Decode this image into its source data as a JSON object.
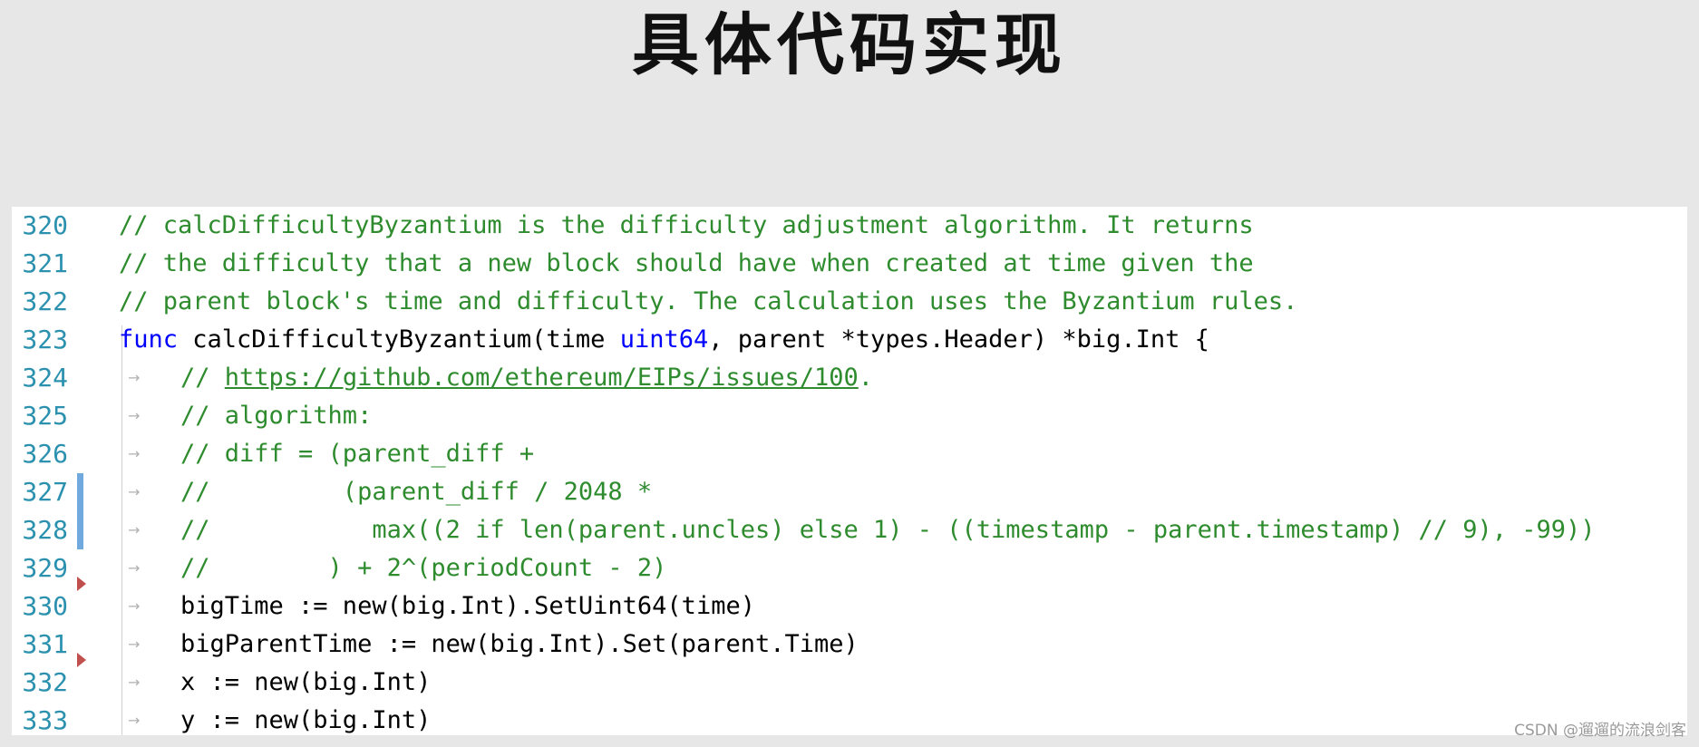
{
  "slide": {
    "title": "具体代码实现",
    "watermark": "CSDN @遛遛的流浪剑客"
  },
  "editor": {
    "lines": [
      {
        "num": "320",
        "comment": "// calcDifficultyByzantium is the difficulty adjustment algorithm. It returns"
      },
      {
        "num": "321",
        "comment": "// the difficulty that a new block should have when created at time given the"
      },
      {
        "num": "322",
        "comment": "// parent block's time and difficulty. The calculation uses the Byzantium rules."
      },
      {
        "num": "323",
        "kw1": "func",
        "mid1": " calcDifficultyByzantium(time ",
        "kw2": "uint64",
        "mid2": ", parent *types.Header) *big.Int {"
      },
      {
        "num": "324",
        "comment_prefix": "// ",
        "link": "https://github.com/ethereum/EIPs/issues/100",
        "comment_suffix": "."
      },
      {
        "num": "325",
        "comment": "// algorithm:"
      },
      {
        "num": "326",
        "comment": "// diff = (parent_diff +"
      },
      {
        "num": "327",
        "comment": "//         (parent_diff / 2048 *"
      },
      {
        "num": "328",
        "comment": "//           max((2 if len(parent.uncles) else 1) - ((timestamp - parent.timestamp) // 9), -99))"
      },
      {
        "num": "329",
        "comment": "//        ) + 2^(periodCount - 2)"
      },
      {
        "num": "330",
        "code": "bigTime := new(big.Int).SetUint64(time)"
      },
      {
        "num": "331",
        "code": "bigParentTime := new(big.Int).Set(parent.Time)"
      },
      {
        "num": "332",
        "code": "x := new(big.Int)"
      },
      {
        "num": "333",
        "code": "y := new(big.Int)"
      }
    ],
    "tab_glyph": "→"
  },
  "colors": {
    "background": "#e7e7e7",
    "line_number": "#2b91af",
    "comment": "#2e8b2e",
    "keyword": "#0000ff",
    "change_bar": "#6fa9dd",
    "breakpoint_marker": "#c0504d"
  }
}
